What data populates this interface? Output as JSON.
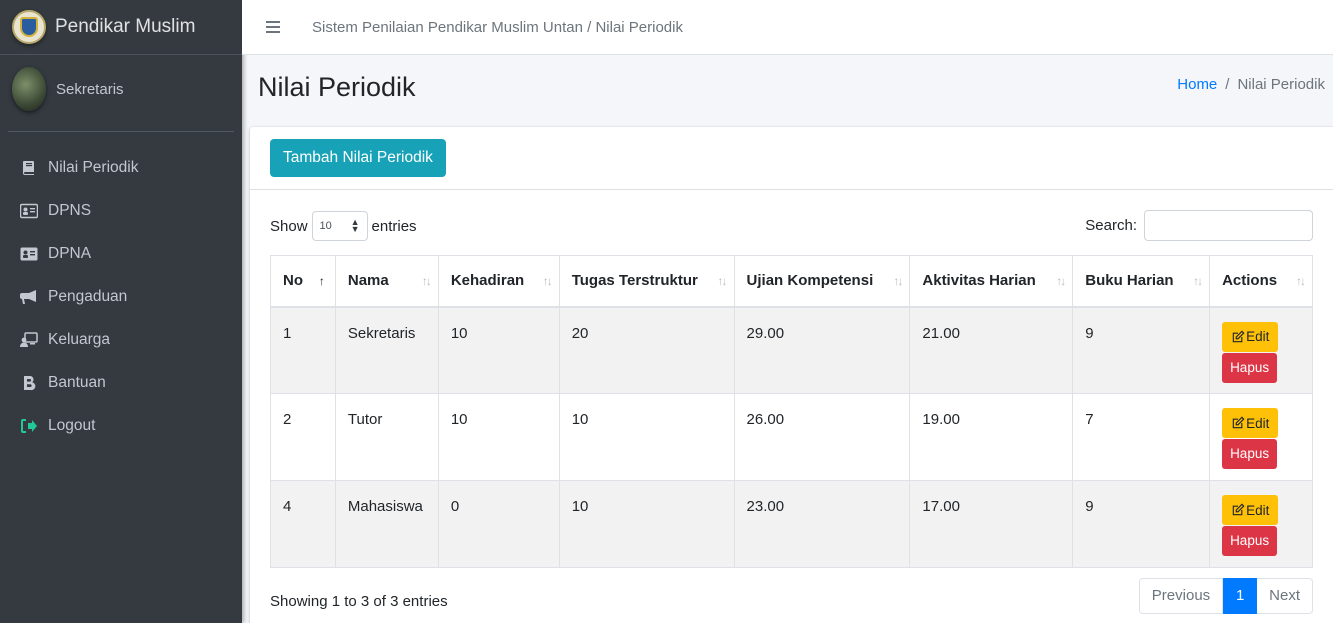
{
  "brand": {
    "name": "Pendikar Muslim"
  },
  "user": {
    "name": "Sekretaris"
  },
  "sidebar": {
    "items": [
      {
        "label": "Nilai Periodik",
        "icon": "book-icon"
      },
      {
        "label": "DPNS",
        "icon": "id-card-icon"
      },
      {
        "label": "DPNA",
        "icon": "id-card-icon"
      },
      {
        "label": "Pengaduan",
        "icon": "bullhorn-icon"
      },
      {
        "label": "Keluarga",
        "icon": "chalkboard-teacher-icon"
      },
      {
        "label": "Bantuan",
        "icon": "bold-b-icon"
      },
      {
        "label": "Logout",
        "icon": "sign-out-icon"
      }
    ]
  },
  "topbar": {
    "title": "Sistem Penilaian Pendikar Muslim Untan / Nilai Periodik"
  },
  "header": {
    "title": "Nilai Periodik",
    "breadcrumb": {
      "home": "Home",
      "separator": "/",
      "current": "Nilai Periodik"
    }
  },
  "card": {
    "add_button": "Tambah Nilai Periodik",
    "show_label": "Show",
    "entries_value": "10",
    "entries_label": "entries",
    "search_label": "Search:",
    "search_value": ""
  },
  "table": {
    "columns": [
      "No",
      "Nama",
      "Kehadiran",
      "Tugas Terstruktur",
      "Ujian Kompetensi",
      "Aktivitas Harian",
      "Buku Harian",
      "Actions"
    ],
    "rows": [
      {
        "no": "1",
        "nama": "Sekretaris",
        "kehadiran": "10",
        "tugas": "20",
        "ujian": "29.00",
        "aktivitas": "21.00",
        "buku": "9"
      },
      {
        "no": "2",
        "nama": "Tutor",
        "kehadiran": "10",
        "tugas": "10",
        "ujian": "26.00",
        "aktivitas": "19.00",
        "buku": "7"
      },
      {
        "no": "4",
        "nama": "Mahasiswa",
        "kehadiran": "0",
        "tugas": "10",
        "ujian": "23.00",
        "aktivitas": "17.00",
        "buku": "9"
      }
    ],
    "edit_label": "Edit",
    "delete_label": "Hapus"
  },
  "footer": {
    "info": "Showing 1 to 3 of 3 entries",
    "previous": "Previous",
    "page": "1",
    "next": "Next"
  },
  "colors": {
    "sidebar": "#343a40",
    "add_button": "#17a2b8",
    "edit_button": "#ffc107",
    "delete_button": "#dc3545",
    "active_page": "#007bff"
  }
}
